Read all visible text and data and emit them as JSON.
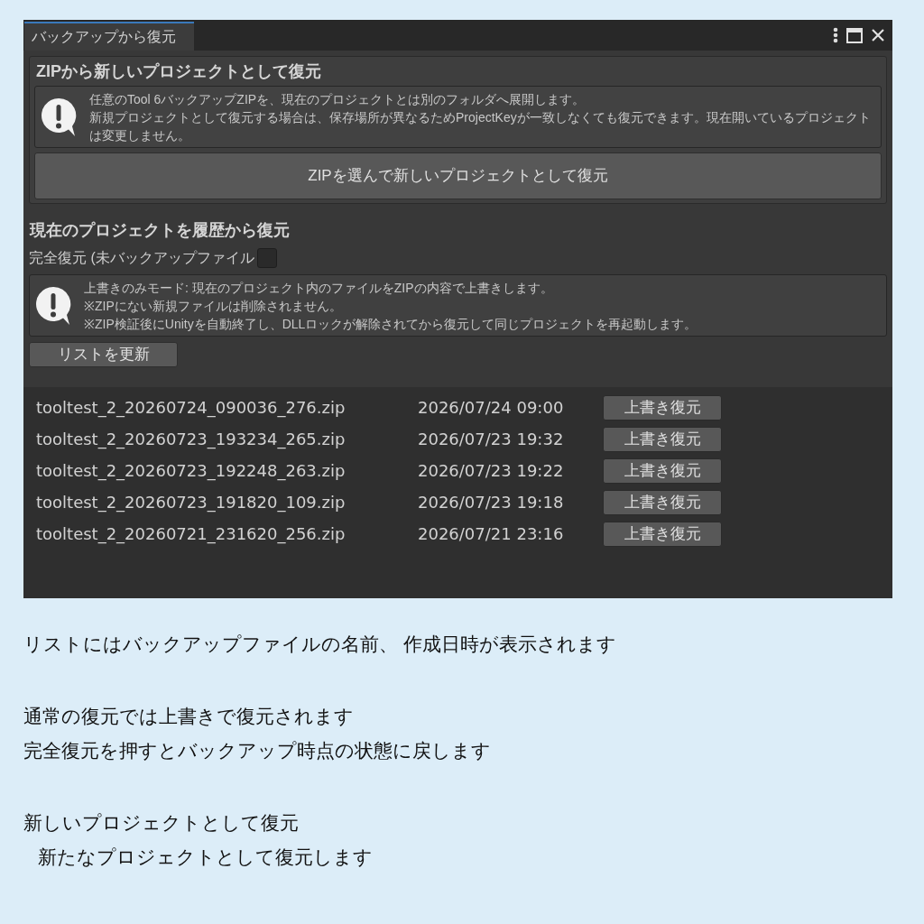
{
  "window": {
    "tab": {
      "label": "バックアップから復元",
      "selected": true
    }
  },
  "new_project_section": {
    "title": "ZIPから新しいプロジェクトとして復元",
    "help": {
      "lines": [
        "任意のTool 6バックアップZIPを、現在のプロジェクトとは別のフォルダへ展開します。",
        "新規プロジェクトとして復元する場合は、保存場所が異なるためProjectKeyが一致しなくても復元できます。現在開いているプロジェクトは変更しません。"
      ]
    },
    "button": "ZIPを選んで新しいプロジェクトとして復元"
  },
  "history_section": {
    "title": "現在のプロジェクトを履歴から復元",
    "full_restore": {
      "label": "完全復元 (未バックアップファイル",
      "checked": false
    },
    "help": {
      "lines": [
        "上書きのみモード: 現在のプロジェクト内のファイルをZIPの内容で上書きします。",
        "※ZIPにない新規ファイルは削除されません。",
        "※ZIP検証後にUnityを自動終了し、DLLロックが解除されてから復元して同じプロジェクトを再起動します。"
      ]
    },
    "refresh_button": "リストを更新",
    "backups": [
      {
        "file": "tooltest_2_20260724_090036_276.zip",
        "date": "2026/07/24 09:00",
        "button": "上書き復元"
      },
      {
        "file": "tooltest_2_20260723_193234_265.zip",
        "date": "2026/07/23 19:32",
        "button": "上書き復元"
      },
      {
        "file": "tooltest_2_20260723_192248_263.zip",
        "date": "2026/07/23 19:22",
        "button": "上書き復元"
      },
      {
        "file": "tooltest_2_20260723_191820_109.zip",
        "date": "2026/07/23 19:18",
        "button": "上書き復元"
      },
      {
        "file": "tooltest_2_20260721_231620_256.zip",
        "date": "2026/07/21 23:16",
        "button": "上書き復元"
      }
    ]
  },
  "notes": [
    {
      "lines": [
        {
          "text": "リストにはバックアップファイルの名前、 作成日時が表示されます"
        }
      ]
    },
    {
      "lines": [
        {
          "text": "通常の復元では上書きで復元されます"
        },
        {
          "text": "完全復元を押すとバックアップ時点の状態に戻します"
        }
      ]
    },
    {
      "lines": [
        {
          "text": "新しいプロジェクトとして復元",
          "children": [
            {
              "text": "新たなプロジェクトとして復元します"
            }
          ]
        }
      ]
    }
  ]
}
